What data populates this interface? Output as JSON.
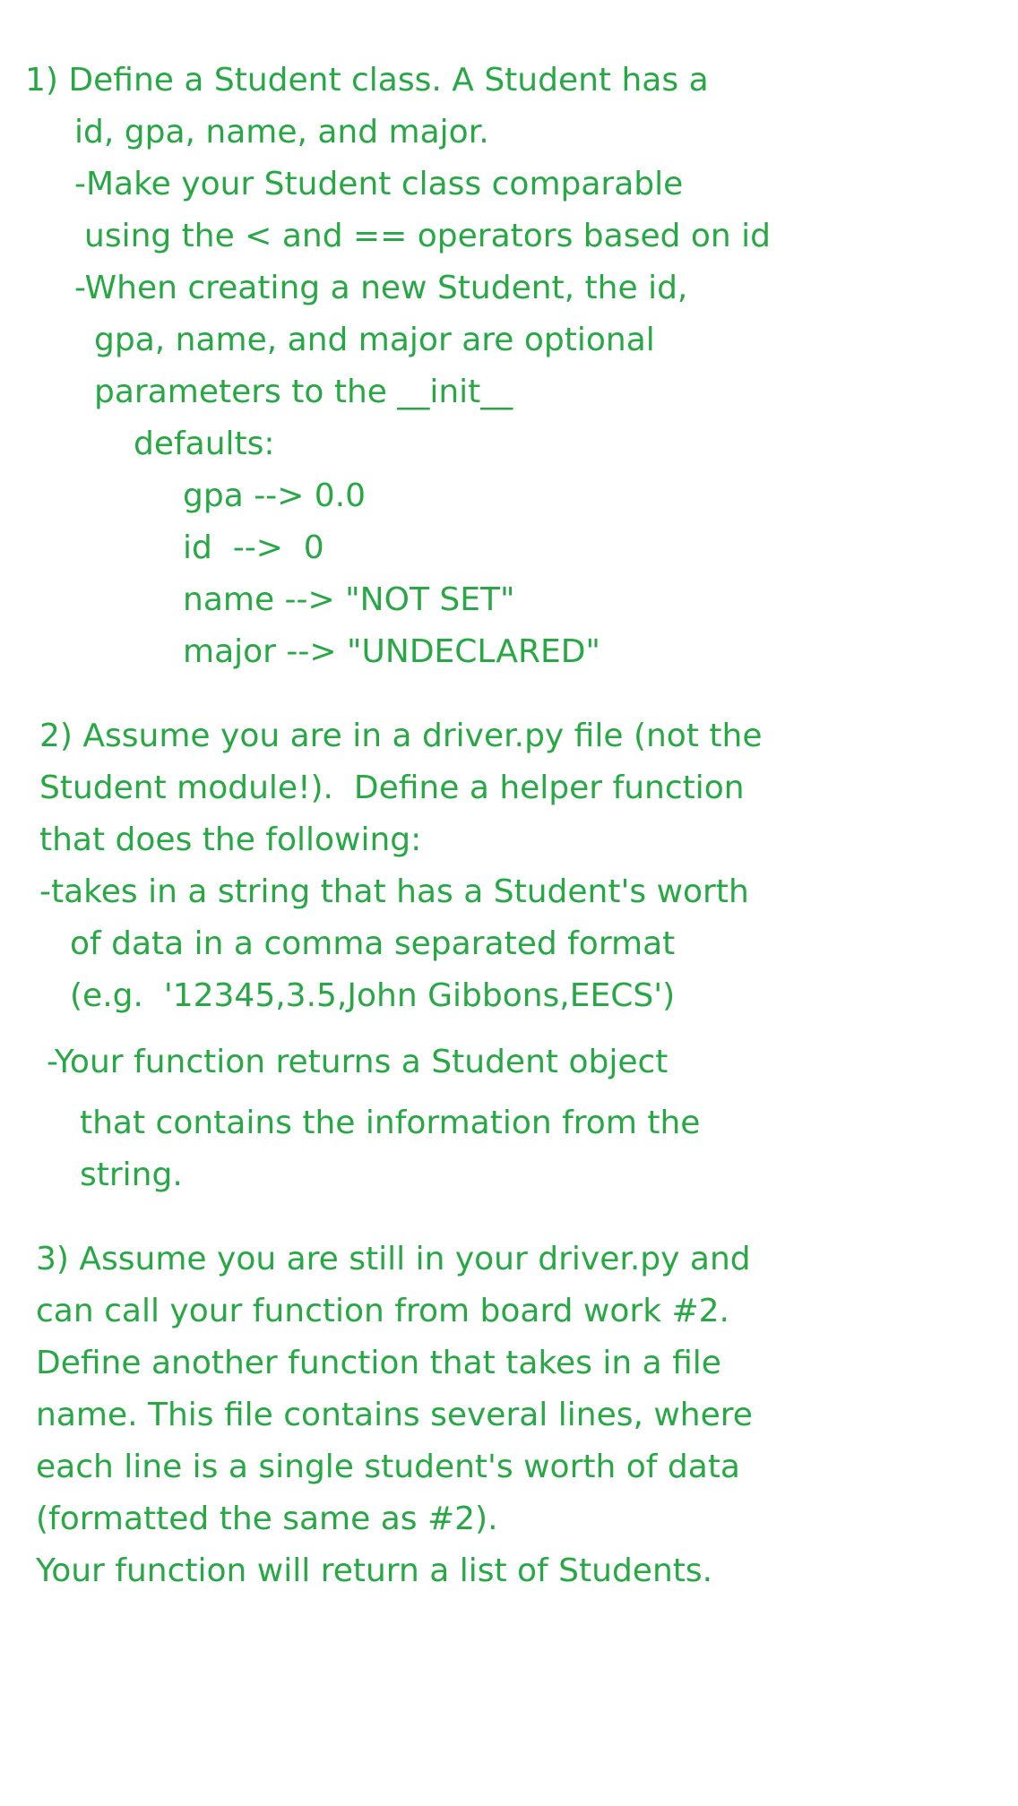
{
  "text_color": "#27a845",
  "sections": [
    {
      "lines": [
        "1) Define a Student class. A Student has a",
        "id, gpa, name, and major.",
        "-Make your Student class comparable",
        "using the < and == operators based on id",
        "-When creating a new Student, the id,",
        "gpa, name, and major are optional",
        "parameters to the __init__",
        "defaults:",
        "gpa --> 0.0",
        "id  -->  0",
        "name --> \"NOT SET\"",
        "major --> \"UNDECLARED\""
      ]
    },
    {
      "lines": [
        "2) Assume you are in a driver.py file (not the",
        "Student module!).  Define a helper function",
        "that does the following:",
        "-takes in a string that has a Student's worth",
        "of data in a comma separated format",
        "(e.g.  '12345,3.5,John Gibbons,EECS')",
        "-Your function returns a Student object",
        "that contains the information from the",
        "string."
      ]
    },
    {
      "lines": [
        "3) Assume you are still in your driver.py and",
        "can call your function from board work #2.",
        "Define another function that takes in a file",
        "name. This file contains several lines, where",
        "each line is a single student's worth of data",
        "(formatted the same as #2).",
        "Your function will return a list of Students."
      ]
    }
  ]
}
